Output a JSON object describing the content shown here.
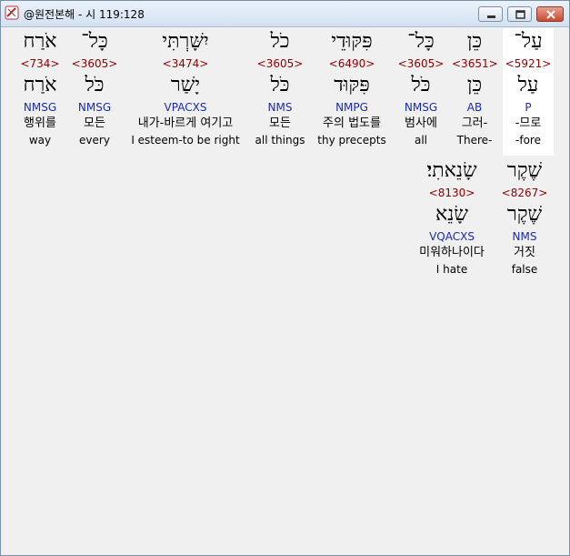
{
  "window": {
    "title": "@원전본해 - 시 119:128"
  },
  "words": [
    {
      "hebrew": "עַל־",
      "strong": "<5921>",
      "lemma": "עַל",
      "morph": "P",
      "korean": "-므로",
      "english": "-fore"
    },
    {
      "hebrew": "כֵּן",
      "strong": "<3651>",
      "lemma": "כֵּן",
      "morph": "AB",
      "korean": "그러-",
      "english": "There-"
    },
    {
      "hebrew": "כָּל־",
      "strong": "<3605>",
      "lemma": "כֹּל",
      "morph": "NMSG",
      "korean": "범사에",
      "english": "all"
    },
    {
      "hebrew": "פִּקּוּדֵי",
      "strong": "<6490>",
      "lemma": "פִּקּוּד",
      "morph": "NMPG",
      "korean": "주의 법도를",
      "english": "thy precepts"
    },
    {
      "hebrew": "כֹל",
      "strong": "<3605>",
      "lemma": "כֹּל",
      "morph": "NMS",
      "korean": "모든",
      "english": "all things"
    },
    {
      "hebrew": "יִשָּׁרְתִּי",
      "strong": "<3474>",
      "lemma": "יָשַׁר",
      "morph": "VPACXS",
      "korean": "내가-바르게 여기고",
      "english": "I esteem-to be right"
    },
    {
      "hebrew": "כָּל־",
      "strong": "<3605>",
      "lemma": "כֹּל",
      "morph": "NMSG",
      "korean": "모든",
      "english": "every"
    },
    {
      "hebrew": "אֹרַח",
      "strong": "<734>",
      "lemma": "אֹרַח",
      "morph": "NMSG",
      "korean": "행위를",
      "english": "way"
    },
    {
      "hebrew": "שֶׁקֶר",
      "strong": "<8267>",
      "lemma": "שֶׁקֶר",
      "morph": "NMS",
      "korean": "거짓",
      "english": "false"
    },
    {
      "hebrew": "שָׂנֵאתִי׃",
      "strong": "<8130>",
      "lemma": "שָׂנֵא",
      "morph": "VQACXS",
      "korean": "미워하나이다",
      "english": "I hate"
    }
  ]
}
